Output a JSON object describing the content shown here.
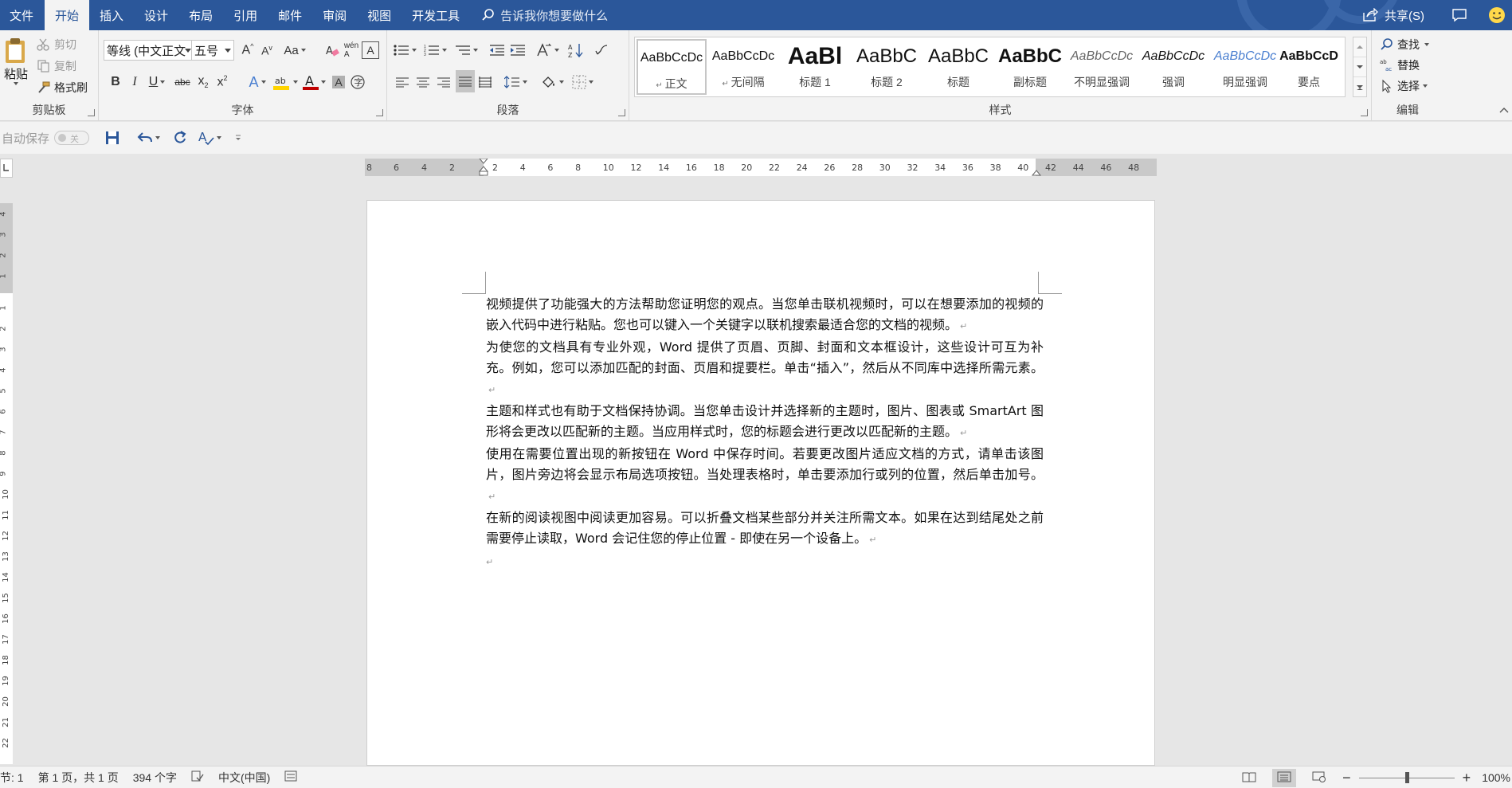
{
  "tabs": [
    "文件",
    "开始",
    "插入",
    "设计",
    "布局",
    "引用",
    "邮件",
    "审阅",
    "视图",
    "开发工具"
  ],
  "active_tab": "开始",
  "tell_me": "告诉我你想要做什么",
  "share": "共享(S)",
  "clipboard": {
    "paste": "粘贴",
    "cut": "剪切",
    "copy": "复制",
    "format_painter": "格式刷",
    "label": "剪贴板"
  },
  "font": {
    "name": "等线 (中文正文",
    "size": "五号",
    "label": "字体",
    "change_case": "Aa"
  },
  "paragraph": {
    "label": "段落"
  },
  "styles": {
    "label": "样式",
    "items": [
      {
        "sample": "AaBbCcDc",
        "name": "正文",
        "selected": true
      },
      {
        "sample": "AaBbCcDc",
        "name": "无间隔"
      },
      {
        "sample": "AaBl",
        "name": "标题 1"
      },
      {
        "sample": "AaBbC",
        "name": "标题 2"
      },
      {
        "sample": "AaBbC",
        "name": "标题"
      },
      {
        "sample": "AaBbC",
        "name": "副标题"
      },
      {
        "sample": "AaBbCcDc",
        "name": "不明显强调"
      },
      {
        "sample": "AaBbCcDc",
        "name": "强调"
      },
      {
        "sample": "AaBbCcDc",
        "name": "明显强调"
      },
      {
        "sample": "AaBbCcD",
        "name": "要点"
      }
    ]
  },
  "editing": {
    "find": "查找",
    "replace": "替换",
    "select": "选择",
    "label": "编辑"
  },
  "qat": {
    "autosave": "自动保存",
    "autosave_state": "关"
  },
  "ruler": {
    "h_left": [
      "8",
      "6",
      "4",
      "2"
    ],
    "h_right": [
      "2",
      "4",
      "6",
      "8",
      "10",
      "12",
      "14",
      "16",
      "18",
      "20",
      "22",
      "24",
      "26",
      "28",
      "30",
      "32",
      "34",
      "36",
      "38",
      "40",
      "42",
      "44",
      "46",
      "48"
    ],
    "v_top": [
      "4",
      "3",
      "2",
      "1"
    ],
    "v_main": [
      "1",
      "2",
      "3",
      "4",
      "5",
      "6",
      "7",
      "8",
      "9",
      "10",
      "11",
      "12",
      "13",
      "14",
      "15",
      "16",
      "17",
      "18",
      "19",
      "20",
      "21",
      "22"
    ]
  },
  "document": {
    "paragraphs": [
      "视频提供了功能强大的方法帮助您证明您的观点。当您单击联机视频时，可以在想要添加的视频的嵌入代码中进行粘贴。您也可以键入一个关键字以联机搜索最适合您的文档的视频。",
      "为使您的文档具有专业外观，Word 提供了页眉、页脚、封面和文本框设计，这些设计可互为补充。例如，您可以添加匹配的封面、页眉和提要栏。单击“插入”，然后从不同库中选择所需元素。",
      "主题和样式也有助于文档保持协调。当您单击设计并选择新的主题时，图片、图表或 SmartArt 图形将会更改以匹配新的主题。当应用样式时，您的标题会进行更改以匹配新的主题。",
      "使用在需要位置出现的新按钮在 Word 中保存时间。若要更改图片适应文档的方式，请单击该图片，图片旁边将会显示布局选项按钮。当处理表格时，单击要添加行或列的位置，然后单击加号。",
      "在新的阅读视图中阅读更加容易。可以折叠文档某些部分并关注所需文本。如果在达到结尾处之前需要停止读取，Word 会记住您的停止位置 - 即使在另一个设备上。",
      ""
    ]
  },
  "status": {
    "section": "节: 1",
    "page": "第 1 页，共 1 页",
    "words": "394 个字",
    "language": "中文(中国)",
    "zoom": "100%"
  },
  "colors": {
    "titlebar": "#2b579a",
    "ribbon": "#f3f3f3",
    "workspace": "#e6e6e6",
    "highlight": "#ffd400",
    "font_color": "#c00000"
  }
}
